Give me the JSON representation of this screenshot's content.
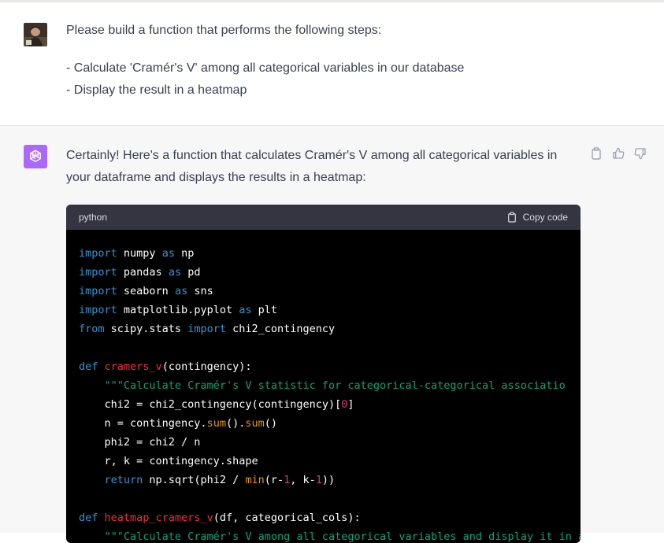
{
  "user_message": {
    "line1": "Please build a function that performs the following steps:",
    "line2": "- Calculate 'Cramér's V' among all categorical variables in our database",
    "line3": "- Display the result in a heatmap"
  },
  "assistant_message": {
    "line1": "Certainly! Here's a function that calculates Cramér's V among all categorical variables in",
    "line2": "your dataframe and displays the results in a heatmap:"
  },
  "code_block": {
    "language": "python",
    "copy_label": "Copy code",
    "lines": [
      [
        {
          "t": "import",
          "c": "k"
        },
        {
          "t": " numpy "
        },
        {
          "t": "as",
          "c": "k"
        },
        {
          "t": " np"
        }
      ],
      [
        {
          "t": "import",
          "c": "k"
        },
        {
          "t": " pandas "
        },
        {
          "t": "as",
          "c": "k"
        },
        {
          "t": " pd"
        }
      ],
      [
        {
          "t": "import",
          "c": "k"
        },
        {
          "t": " seaborn "
        },
        {
          "t": "as",
          "c": "k"
        },
        {
          "t": " sns"
        }
      ],
      [
        {
          "t": "import",
          "c": "k"
        },
        {
          "t": " matplotlib.pyplot "
        },
        {
          "t": "as",
          "c": "k"
        },
        {
          "t": " plt"
        }
      ],
      [
        {
          "t": "from",
          "c": "k"
        },
        {
          "t": " scipy.stats "
        },
        {
          "t": "import",
          "c": "k"
        },
        {
          "t": " chi2_contingency"
        }
      ],
      [],
      [
        {
          "t": "def",
          "c": "k"
        },
        {
          "t": " "
        },
        {
          "t": "cramers_v",
          "c": "f"
        },
        {
          "t": "(contingency):"
        }
      ],
      [
        {
          "t": "    "
        },
        {
          "t": "\"\"\"Calculate Cramér's V statistic for categorical-categorical associatio",
          "c": "s"
        }
      ],
      [
        {
          "t": "    chi2 = chi2_contingency(contingency)["
        },
        {
          "t": "0",
          "c": "n"
        },
        {
          "t": "]"
        }
      ],
      [
        {
          "t": "    n = contingency."
        },
        {
          "t": "sum",
          "c": "b"
        },
        {
          "t": "()."
        },
        {
          "t": "sum",
          "c": "b"
        },
        {
          "t": "()"
        }
      ],
      [
        {
          "t": "    phi2 = chi2 / n"
        }
      ],
      [
        {
          "t": "    r, k = contingency.shape"
        }
      ],
      [
        {
          "t": "    "
        },
        {
          "t": "return",
          "c": "k"
        },
        {
          "t": " np.sqrt(phi2 / "
        },
        {
          "t": "min",
          "c": "b"
        },
        {
          "t": "(r-"
        },
        {
          "t": "1",
          "c": "n"
        },
        {
          "t": ", k-"
        },
        {
          "t": "1",
          "c": "n"
        },
        {
          "t": "))"
        }
      ],
      [],
      [
        {
          "t": "def",
          "c": "k"
        },
        {
          "t": " "
        },
        {
          "t": "heatmap_cramers_v",
          "c": "f"
        },
        {
          "t": "(df, categorical_cols):"
        }
      ],
      [
        {
          "t": "    "
        },
        {
          "t": "\"\"\"Calculate Cramér's V among all categorical variables and display it in a heatmap.",
          "c": "s"
        }
      ]
    ]
  },
  "colors": {
    "gpt_avatar_bg": "#ab68ff",
    "code_bg": "#000000",
    "code_header_bg": "#343541"
  }
}
